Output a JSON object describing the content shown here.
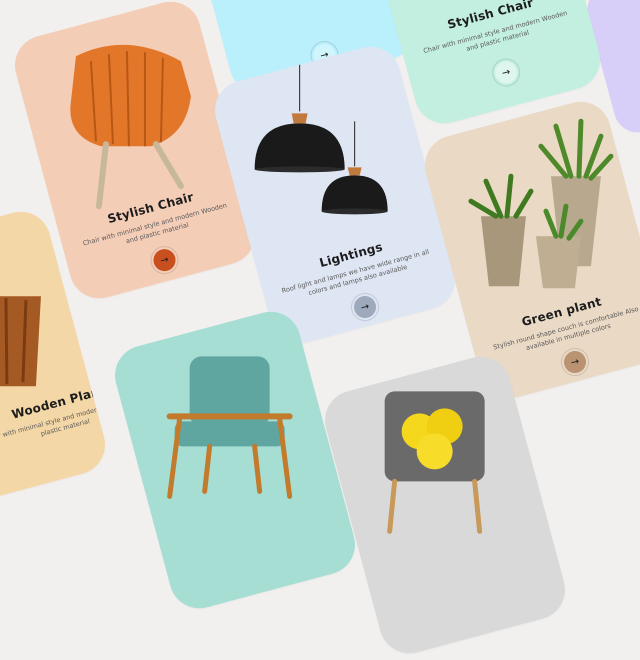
{
  "cards": {
    "top_blue": {
      "bg": "#b9f0fb"
    },
    "stylish_top": {
      "title": "Stylish Chair",
      "desc": "Chair with minimal style and modern Wooden and plastic material",
      "bg": "#c3efe0"
    },
    "stylish_main": {
      "title": "Stylish Chair",
      "desc": "Chair with minimal style and modern Wooden and plastic material",
      "bg": "#f4cdb7"
    },
    "lightings": {
      "title": "Lightings",
      "desc": "Roof light and lamps we have wide range in all colors and lamps also available",
      "bg": "#dfe6f3"
    },
    "green_plant": {
      "title": "Green plant",
      "desc": "Stylish round shape couch is comfortable Also available in multiple colors",
      "bg": "#ead9c5"
    },
    "wooden_plant": {
      "title": "Wooden Plant",
      "desc": "Chair with minimal style and modern Wooden and plastic material",
      "bg": "#f4d7a6"
    },
    "armchair": {
      "bg": "#a7ded3"
    },
    "knot_chair": {
      "bg": "#d9d9d9"
    }
  },
  "button": {
    "arrow": "→"
  },
  "icons": [
    "arrow-right-icon"
  ]
}
